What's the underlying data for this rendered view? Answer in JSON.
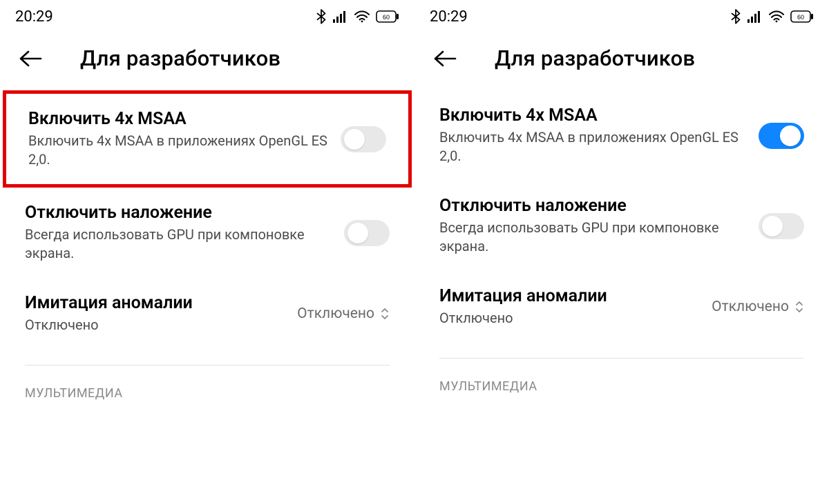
{
  "left": {
    "status_time": "20:29",
    "battery": "60",
    "header_title": "Для разработчиков",
    "rows": {
      "msaa": {
        "title": "Включить 4x MSAA",
        "sub": "Включить 4x MSAA в приложениях OpenGL ES 2,0.",
        "on": false,
        "highlighted": true
      },
      "overlay": {
        "title": "Отключить наложение",
        "sub": "Всегда использовать GPU при компоновке экрана.",
        "on": false
      },
      "anomaly": {
        "title": "Имитация аномалии",
        "sub": "Отключено",
        "value": "Отключено"
      }
    },
    "section_label": "МУЛЬТИМЕДИА"
  },
  "right": {
    "status_time": "20:29",
    "battery": "60",
    "header_title": "Для разработчиков",
    "rows": {
      "msaa": {
        "title": "Включить 4x MSAA",
        "sub": "Включить 4x MSAA в приложениях OpenGL ES 2,0.",
        "on": true,
        "highlighted": false
      },
      "overlay": {
        "title": "Отключить наложение",
        "sub": "Всегда использовать GPU при компоновке экрана.",
        "on": false
      },
      "anomaly": {
        "title": "Имитация аномалии",
        "sub": "Отключено",
        "value": "Отключено"
      }
    },
    "section_label": "МУЛЬТИМЕДИА"
  }
}
